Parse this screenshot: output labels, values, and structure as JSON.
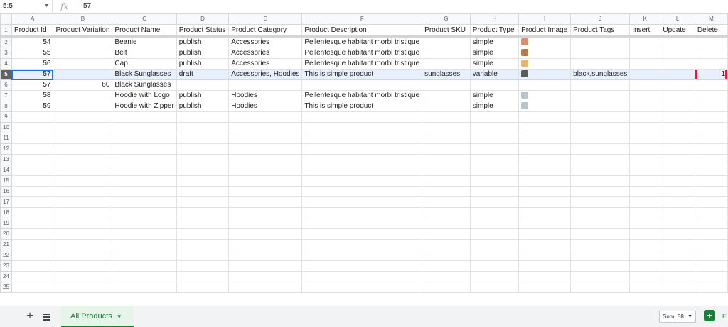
{
  "formula_bar": {
    "name_box": "5:5",
    "fx_symbol": "fx",
    "value": "57"
  },
  "columns": [
    "A",
    "B",
    "C",
    "D",
    "E",
    "F",
    "G",
    "H",
    "I",
    "J",
    "K",
    "L",
    "M"
  ],
  "rows": [
    {
      "num": "1",
      "cells": [
        "Product Id",
        "Product Variation",
        "Product Name",
        "Product Status",
        "Product Category",
        "Product Description",
        "Product SKU",
        "Product Type",
        "Product Image",
        "Product Tags",
        "Insert",
        "Update",
        "Delete"
      ]
    },
    {
      "num": "2",
      "cells": [
        "54",
        "",
        "Beanie",
        "publish",
        "Accessories",
        "Pellentesque habitant morbi tristique",
        "",
        "simple",
        "",
        "",
        "",
        "",
        ""
      ],
      "thumb": "#e28b6b"
    },
    {
      "num": "3",
      "cells": [
        "55",
        "",
        "Belt",
        "publish",
        "Accessories",
        "Pellentesque habitant morbi tristique",
        "",
        "simple",
        "",
        "",
        "",
        "",
        ""
      ],
      "thumb": "#b87a4b"
    },
    {
      "num": "4",
      "cells": [
        "56",
        "",
        "Cap",
        "publish",
        "Accessories",
        "Pellentesque habitant morbi tristique",
        "",
        "simple",
        "",
        "",
        "",
        "",
        ""
      ],
      "thumb": "#e8b86a"
    },
    {
      "num": "5",
      "cells": [
        "57",
        "",
        "Black Sunglasses",
        "draft",
        "Accessories, Hoodies",
        "This is simple product",
        "sunglasses",
        "variable",
        "",
        "black,sunglasses",
        "",
        "",
        "1"
      ],
      "thumb": "#5a5a5a",
      "selected": true
    },
    {
      "num": "6",
      "cells": [
        "57",
        "60",
        "Black Sunglasses",
        "",
        "",
        "",
        "",
        "",
        "",
        "",
        "",
        "",
        ""
      ]
    },
    {
      "num": "7",
      "cells": [
        "58",
        "",
        "Hoodie with Logo",
        "publish",
        "Hoodies",
        "Pellentesque habitant morbi tristique",
        "",
        "simple",
        "",
        "",
        "",
        "",
        ""
      ],
      "thumb": "#b9c3cc"
    },
    {
      "num": "8",
      "cells": [
        "59",
        "",
        "Hoodie with Zipper",
        "publish",
        "Hoodies",
        "This is simple product",
        "",
        "simple",
        "",
        "",
        "",
        "",
        ""
      ],
      "thumb": "#b9c3cc"
    },
    {
      "num": "9",
      "cells": []
    },
    {
      "num": "10",
      "cells": []
    },
    {
      "num": "11",
      "cells": []
    },
    {
      "num": "12",
      "cells": []
    },
    {
      "num": "13",
      "cells": []
    },
    {
      "num": "14",
      "cells": []
    },
    {
      "num": "15",
      "cells": []
    },
    {
      "num": "16",
      "cells": []
    },
    {
      "num": "17",
      "cells": []
    },
    {
      "num": "18",
      "cells": []
    },
    {
      "num": "19",
      "cells": []
    },
    {
      "num": "20",
      "cells": []
    },
    {
      "num": "21",
      "cells": []
    },
    {
      "num": "22",
      "cells": []
    },
    {
      "num": "23",
      "cells": []
    },
    {
      "num": "24",
      "cells": []
    },
    {
      "num": "25",
      "cells": []
    }
  ],
  "bottom_bar": {
    "add_sheet": "+",
    "sheet_tab": "All Products",
    "sum_label": "Sum: 58",
    "explore_label": "E"
  },
  "colors": {
    "selected_row": "#e8f0fe",
    "highlight_border": "#e0202e",
    "accent": "#188038"
  }
}
